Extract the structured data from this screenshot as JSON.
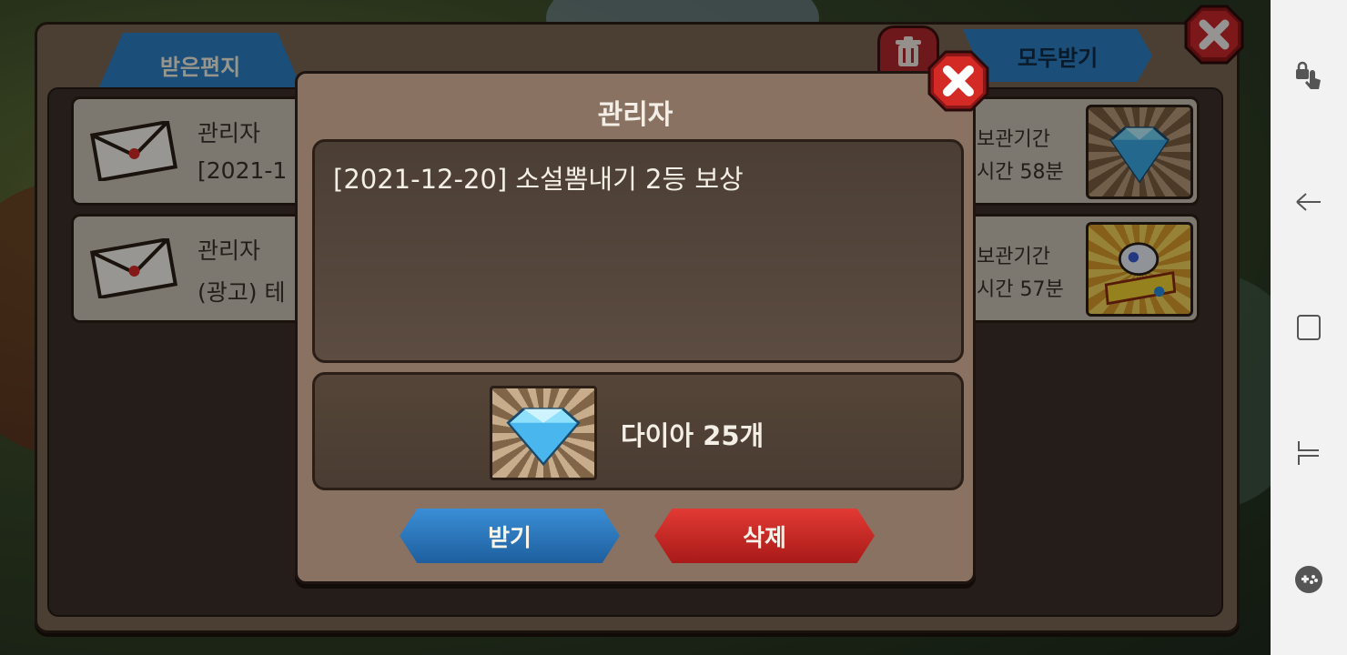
{
  "mailbox": {
    "tab_label": "받은편지",
    "receive_all_label": "모두받기",
    "rows": [
      {
        "sender": "관리자",
        "subject": "[2021-1",
        "keep_label": "보관기간",
        "keep_time": "시간 58분",
        "reward_icon": "diamond-icon"
      },
      {
        "sender": "관리자",
        "subject": "(광고) 테",
        "keep_label": "보관기간",
        "keep_time": "시간 57분",
        "reward_icon": "level-up-icon"
      }
    ]
  },
  "modal": {
    "title": "관리자",
    "message": "[2021-12-20] 소설뽐내기 2등 보상",
    "reward_text": "다이아 25개",
    "reward_icon": "diamond-icon",
    "receive_label": "받기",
    "delete_label": "삭제"
  },
  "system_bar": {
    "icons": [
      "touch-lock-icon",
      "back-icon",
      "recent-apps-icon",
      "fold-icon",
      "game-tools-icon"
    ]
  },
  "colors": {
    "accent_blue": "#2d7fc4",
    "delete_red": "#d42a26",
    "panel_brown": "#8a7262"
  }
}
